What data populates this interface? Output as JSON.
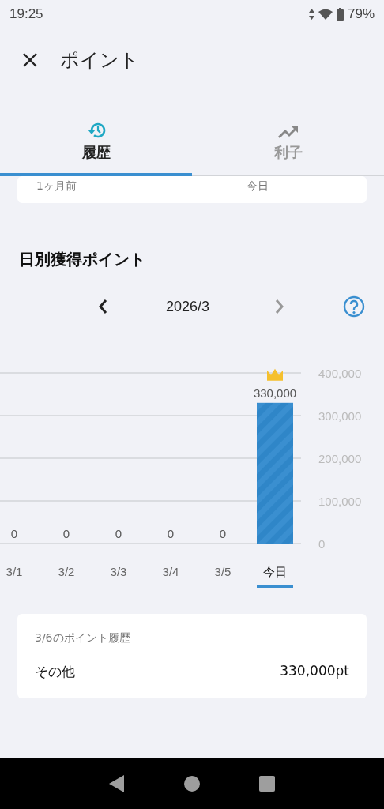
{
  "status_bar": {
    "time": "19:25",
    "battery": "79%"
  },
  "header": {
    "title": "ポイント"
  },
  "tabs": [
    {
      "label": "履歴",
      "kind": "history",
      "selected": true
    },
    {
      "label": "利子",
      "kind": "trend",
      "selected": false
    }
  ],
  "range_card": {
    "start": "1ヶ月前",
    "end": "今日"
  },
  "section_title": "日別獲得ポイント",
  "month_nav": {
    "label": "2026/3",
    "next_disabled": true
  },
  "chart": {
    "x_selected": [
      false,
      false,
      false,
      false,
      false,
      true
    ],
    "chart_data": {
      "type": "bar",
      "categories": [
        "3/1",
        "3/2",
        "3/3",
        "3/4",
        "3/5",
        "今日"
      ],
      "series": [
        {
          "color": "#3a8fd0",
          "values": [
            0,
            0,
            0,
            0,
            0,
            330000
          ]
        }
      ],
      "grid": true,
      "ylim": [
        0,
        400000
      ],
      "yticks": [
        {
          "value": 0,
          "label": "0"
        },
        {
          "value": 100000,
          "label": "100,000"
        },
        {
          "value": 200000,
          "label": "200,000"
        },
        {
          "value": 300000,
          "label": "300,000"
        },
        {
          "value": 400000,
          "label": "400,000"
        }
      ],
      "value_labels": [
        "0",
        "0",
        "0",
        "0",
        "0",
        "330,000"
      ]
    }
  },
  "history_card": {
    "title": "3/6のポイント履歴",
    "rows": [
      {
        "label": "その他",
        "value": "330,000pt"
      }
    ]
  }
}
